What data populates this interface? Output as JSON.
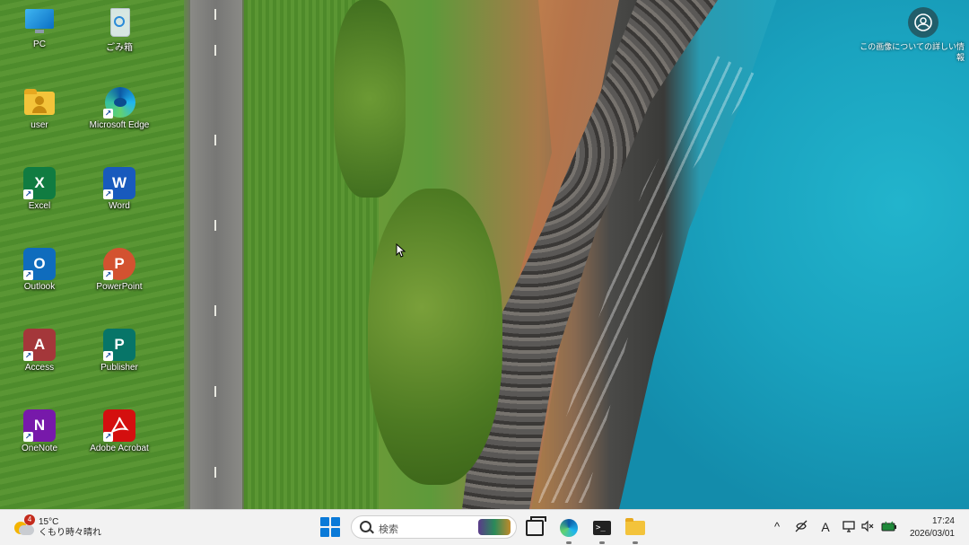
{
  "desktop": {
    "icons": [
      {
        "label": "PC"
      },
      {
        "label": "ごみ箱"
      },
      {
        "label": "user"
      },
      {
        "label": "Microsoft Edge"
      },
      {
        "label": "Excel",
        "letter": "X"
      },
      {
        "label": "Word",
        "letter": "W"
      },
      {
        "label": "Outlook",
        "letter": "O"
      },
      {
        "label": "PowerPoint",
        "letter": "P"
      },
      {
        "label": "Access",
        "letter": "A"
      },
      {
        "label": "Publisher",
        "letter": "P"
      },
      {
        "label": "OneNote",
        "letter": "N"
      },
      {
        "label": "Adobe Acrobat"
      }
    ],
    "shortcut_arrow": "↗",
    "account_caption": "この画像についての詳しい情報"
  },
  "taskbar": {
    "weather": {
      "temp": "15°C",
      "condition": "くもり時々晴れ",
      "badge": "4"
    },
    "search": {
      "placeholder": "検索"
    },
    "terminal_glyph": ">_",
    "tray": {
      "chevron": "^",
      "ime": "A"
    },
    "clock": {
      "time": "17:24",
      "date": "2026/03/01"
    }
  },
  "colors": {
    "excel": "#107c41",
    "word": "#185abd",
    "outlook": "#0f6cbd",
    "powerpoint": "#d35230",
    "access": "#a4373a",
    "publisher": "#077568",
    "onenote": "#7719aa",
    "acrobat": "#d40f0f",
    "start": "#0a7ad8"
  }
}
